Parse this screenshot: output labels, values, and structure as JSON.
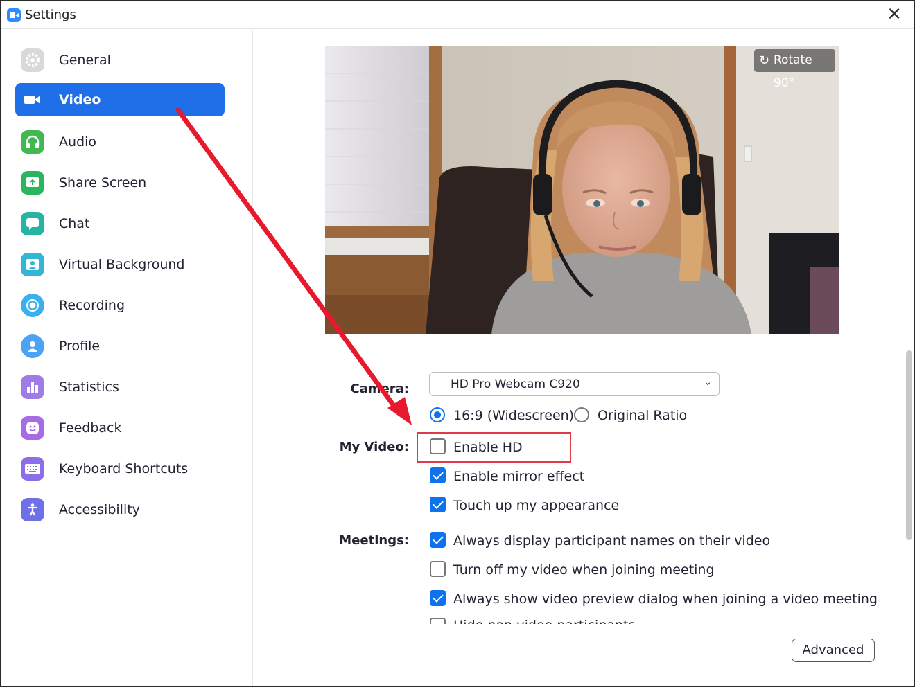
{
  "window": {
    "title": "Settings",
    "close_glyph": "✕",
    "app_icon": "zoom-camera-icon"
  },
  "sidebar": {
    "items": [
      {
        "label": "General",
        "icon": "gear-icon",
        "color": "#d9d9d9",
        "active": false
      },
      {
        "label": "Video",
        "icon": "video-camera-icon",
        "color": "#1e6fe8",
        "active": true
      },
      {
        "label": "Audio",
        "icon": "headphones-icon",
        "color": "#3fb950",
        "active": false
      },
      {
        "label": "Share Screen",
        "icon": "share-screen-icon",
        "color": "#2cb55f",
        "active": false
      },
      {
        "label": "Chat",
        "icon": "chat-bubble-icon",
        "color": "#26b5a3",
        "active": false
      },
      {
        "label": "Virtual Background",
        "icon": "virtual-background-icon",
        "color": "#31b6d6",
        "active": false
      },
      {
        "label": "Recording",
        "icon": "record-icon",
        "color": "#3ab0ef",
        "active": false
      },
      {
        "label": "Profile",
        "icon": "person-icon",
        "color": "#4da3f3",
        "active": false
      },
      {
        "label": "Statistics",
        "icon": "bar-chart-icon",
        "color": "#9f7be6",
        "active": false
      },
      {
        "label": "Feedback",
        "icon": "smiley-icon",
        "color": "#a76be6",
        "active": false
      },
      {
        "label": "Keyboard Shortcuts",
        "icon": "keyboard-icon",
        "color": "#8c6ee8",
        "active": false
      },
      {
        "label": "Accessibility",
        "icon": "accessibility-icon",
        "color": "#6f6fe6",
        "active": false
      }
    ]
  },
  "preview": {
    "rotate_label": "Rotate 90°",
    "rotate_glyph": "↻"
  },
  "camera": {
    "label": "Camera:",
    "value": "HD Pro Webcam C920",
    "chevron": "⌄"
  },
  "aspect": {
    "options": [
      {
        "label": "16:9 (Widescreen)",
        "selected": true
      },
      {
        "label": "Original Ratio",
        "selected": false
      }
    ]
  },
  "my_video": {
    "label": "My Video:",
    "options": [
      {
        "label": "Enable HD",
        "checked": false
      },
      {
        "label": "Enable mirror effect",
        "checked": true
      },
      {
        "label": "Touch up my appearance",
        "checked": true
      }
    ]
  },
  "meetings": {
    "label": "Meetings:",
    "options": [
      {
        "label": "Always display participant names on their video",
        "checked": true
      },
      {
        "label": "Turn off my video when joining meeting",
        "checked": false
      },
      {
        "label": "Always show video preview dialog when joining a video meeting",
        "checked": true
      },
      {
        "label": "Hide non-video participants",
        "checked": false
      }
    ]
  },
  "footer": {
    "advanced_label": "Advanced"
  },
  "colors": {
    "accent": "#0e72ed",
    "highlight": "#e0394c",
    "annotation_arrow": "#e8192c"
  }
}
